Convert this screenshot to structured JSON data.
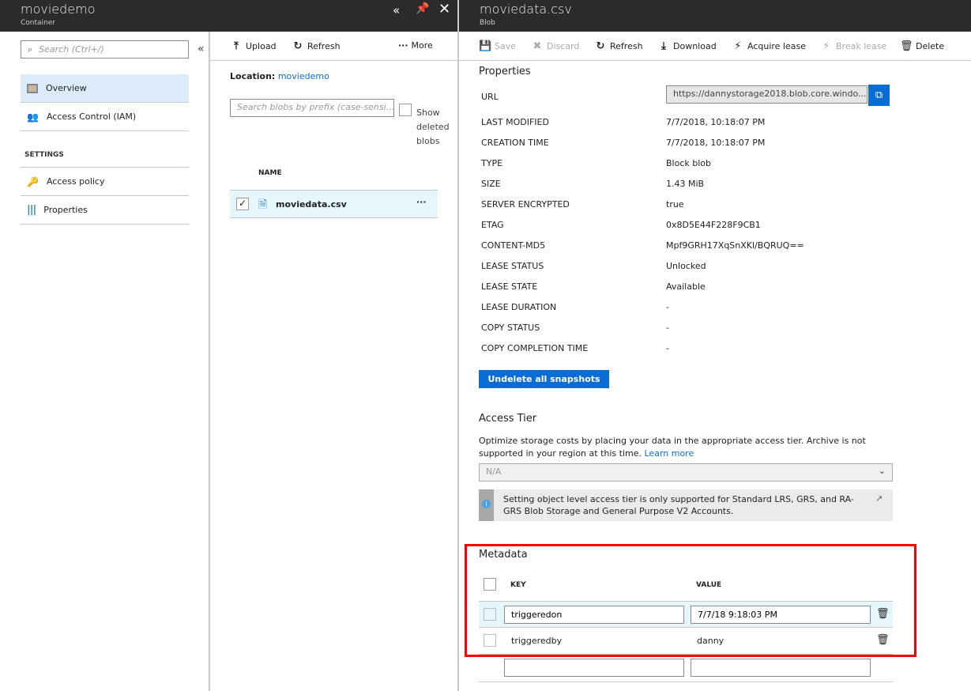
{
  "left_blade": {
    "title": "moviedemo",
    "subtitle": "Container"
  },
  "nav": {
    "search_placeholder": "Search (Ctrl+/)",
    "items": [
      {
        "label": "Overview",
        "icon": "overview-icon"
      },
      {
        "label": "Access Control (IAM)",
        "icon": "iam-icon"
      }
    ],
    "section": "SETTINGS",
    "settings_items": [
      {
        "label": "Access policy",
        "icon": "key-icon"
      },
      {
        "label": "Properties",
        "icon": "properties-icon"
      }
    ]
  },
  "blobs": {
    "toolbar": {
      "upload": "Upload",
      "refresh": "Refresh",
      "more": "More"
    },
    "location_label": "Location:",
    "location_value": "moviedemo",
    "search_placeholder": "Search blobs by prefix (case-sensi...",
    "show_deleted": "Show deleted blobs",
    "name_header": "NAME",
    "rows": [
      {
        "name": "moviedata.csv",
        "checked": true
      }
    ]
  },
  "right_blade": {
    "title": "moviedata.csv",
    "subtitle": "Blob"
  },
  "toolbar": {
    "save": "Save",
    "discard": "Discard",
    "refresh": "Refresh",
    "download": "Download",
    "acquire": "Acquire lease",
    "break": "Break lease",
    "delete": "Delete"
  },
  "properties": {
    "heading": "Properties",
    "url_label": "URL",
    "url_value": "https://dannystorage2018.blob.core.windo...",
    "rows": [
      {
        "label": "LAST MODIFIED",
        "value": "7/7/2018, 10:18:07 PM"
      },
      {
        "label": "CREATION TIME",
        "value": "7/7/2018, 10:18:07 PM"
      },
      {
        "label": "TYPE",
        "value": "Block blob"
      },
      {
        "label": "SIZE",
        "value": "1.43 MiB"
      },
      {
        "label": "SERVER ENCRYPTED",
        "value": "true"
      },
      {
        "label": "ETAG",
        "value": "0x8D5E44F228F9CB1"
      },
      {
        "label": "CONTENT-MD5",
        "value": "Mpf9GRH17XqSnXKl/BQRUQ=="
      },
      {
        "label": "LEASE STATUS",
        "value": "Unlocked"
      },
      {
        "label": "LEASE STATE",
        "value": "Available"
      },
      {
        "label": "LEASE DURATION",
        "value": "-"
      },
      {
        "label": "COPY STATUS",
        "value": "-"
      },
      {
        "label": "COPY COMPLETION TIME",
        "value": "-"
      }
    ],
    "undelete": "Undelete all snapshots"
  },
  "access_tier": {
    "heading": "Access Tier",
    "desc": "Optimize storage costs by placing your data in the appropriate access tier. Archive is not supported in your region at this time.",
    "learn_more": "Learn more",
    "select_value": "N/A",
    "info": "Setting object level access tier is only supported for Standard LRS, GRS, and RA-GRS Blob Storage and General Purpose V2 Accounts."
  },
  "metadata": {
    "heading": "Metadata",
    "key_header": "KEY",
    "value_header": "VALUE",
    "rows": [
      {
        "key": "triggeredon",
        "value": "7/7/18 9:18:03 PM"
      },
      {
        "key": "triggeredby",
        "value": "danny"
      }
    ],
    "highlight_color": "#ff0000"
  }
}
